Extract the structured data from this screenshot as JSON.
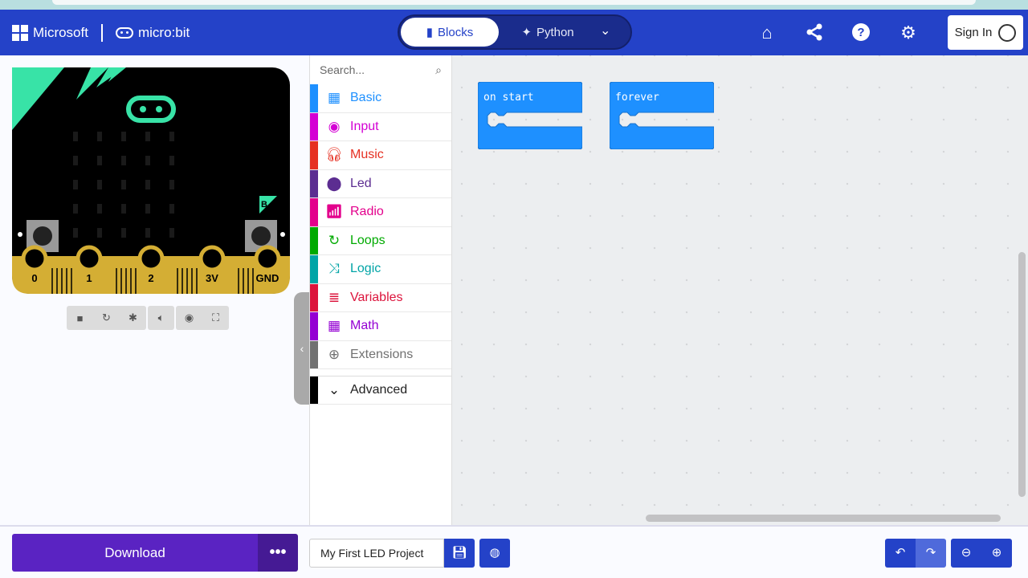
{
  "header": {
    "brand": "Microsoft",
    "product": "micro:bit",
    "tabs": [
      {
        "label": "Blocks",
        "icon": "puzzle-icon",
        "active": true
      },
      {
        "label": "Python",
        "icon": "python-icon",
        "active": false
      }
    ],
    "icons": [
      "home-icon",
      "share-icon",
      "help-icon",
      "gear-icon"
    ],
    "sign_in": "Sign In"
  },
  "simulator": {
    "pins": [
      "0",
      "1",
      "2",
      "3V",
      "GND"
    ],
    "buttons": [
      "A",
      "B"
    ],
    "controls": [
      "stop-icon",
      "restart-icon",
      "debug-icon",
      "sound-icon",
      "screenshot-icon",
      "fullscreen-icon"
    ]
  },
  "toolbox": {
    "search_placeholder": "Search...",
    "categories": [
      {
        "label": "Basic",
        "color": "#1e90ff",
        "icon": "grid-icon"
      },
      {
        "label": "Input",
        "color": "#d400d4",
        "icon": "input-icon"
      },
      {
        "label": "Music",
        "color": "#e63022",
        "icon": "headphones-icon"
      },
      {
        "label": "Led",
        "color": "#5c2d91",
        "icon": "toggle-icon"
      },
      {
        "label": "Radio",
        "color": "#e3008c",
        "icon": "signal-icon"
      },
      {
        "label": "Loops",
        "color": "#00aa00",
        "icon": "loop-icon"
      },
      {
        "label": "Logic",
        "color": "#00a4a6",
        "icon": "shuffle-icon"
      },
      {
        "label": "Variables",
        "color": "#dc143c",
        "icon": "list-icon"
      },
      {
        "label": "Math",
        "color": "#9400d3",
        "icon": "calculator-icon"
      },
      {
        "label": "Extensions",
        "color": "#717171",
        "icon": "plus-circle-icon"
      }
    ],
    "advanced": "Advanced"
  },
  "workspace": {
    "blocks": [
      {
        "label": "on start",
        "color": "#1e90ff"
      },
      {
        "label": "forever",
        "color": "#1e90ff"
      }
    ]
  },
  "footer": {
    "download": "Download",
    "more": "•••",
    "project_name": "My First LED Project"
  }
}
